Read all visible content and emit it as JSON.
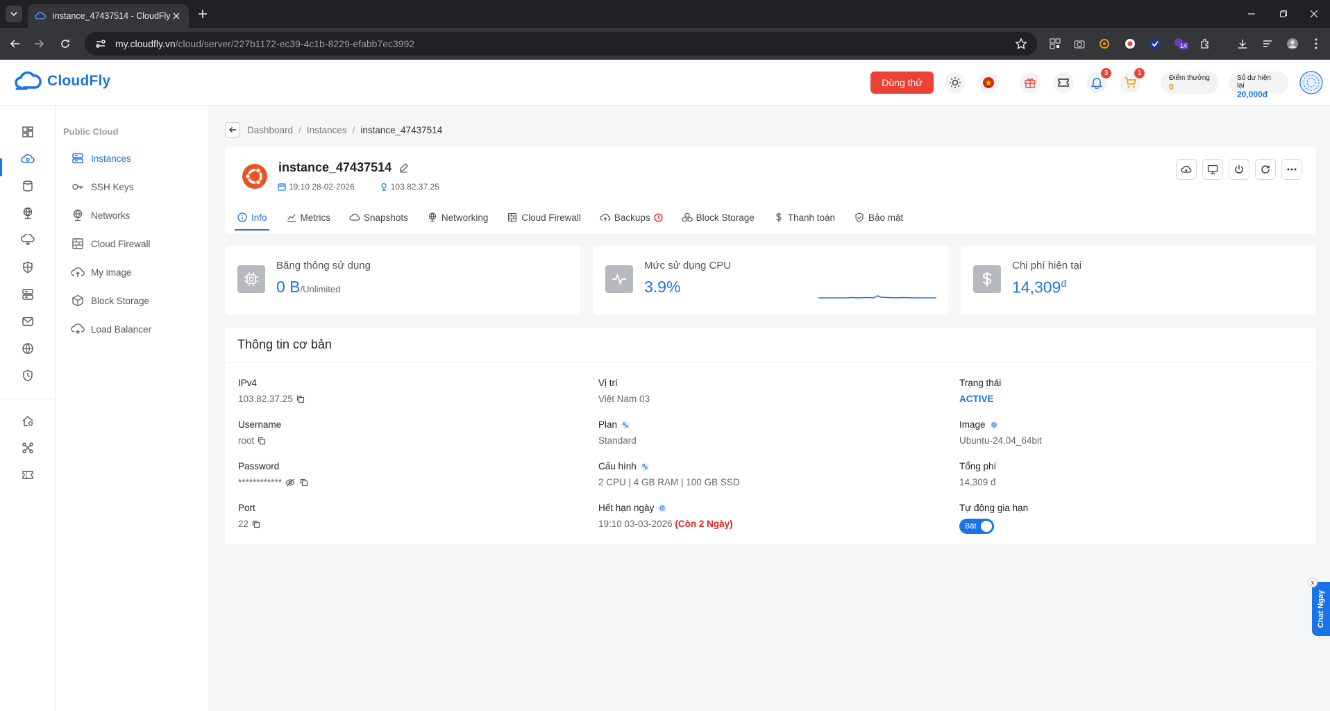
{
  "browser": {
    "tab_title": "instance_47437514 - CloudFly",
    "url_host": "my.cloudfly.vn",
    "url_path": "/cloud/server/227b1172-ec39-4c1b-8229-efabb7ec3992",
    "ext_badge": "14"
  },
  "header": {
    "logo_text": "CloudFly",
    "try_label": "Dùng thử",
    "notif_count": "3",
    "cart_count": "1",
    "points_label": "Điểm thưởng",
    "points_value": "0",
    "balance_label": "Số dư hiện tại",
    "balance_value": "20,000đ",
    "brand_color": "#1a73e8"
  },
  "sidebar": {
    "section": "Public Cloud",
    "items": [
      {
        "label": "Instances",
        "icon": "server-icon"
      },
      {
        "label": "SSH Keys",
        "icon": "key-icon"
      },
      {
        "label": "Networks",
        "icon": "network-icon"
      },
      {
        "label": "Cloud Firewall",
        "icon": "firewall-icon"
      },
      {
        "label": "My image",
        "icon": "cloud-upload-icon"
      },
      {
        "label": "Block Storage",
        "icon": "cube-icon"
      },
      {
        "label": "Load Balancer",
        "icon": "cloud-balance-icon"
      }
    ]
  },
  "breadcrumb": {
    "items": [
      "Dashboard",
      "Instances",
      "instance_47437514"
    ]
  },
  "instance": {
    "name": "instance_47437514",
    "created": "19:10 28-02-2026",
    "ip": "103.82.37.25"
  },
  "tabs": [
    "Info",
    "Metrics",
    "Snapshots",
    "Networking",
    "Cloud Firewall",
    "Backups",
    "Block Storage",
    "Thanh toán",
    "Bảo mật"
  ],
  "stats": [
    {
      "label": "Băng thông sử dụng",
      "value": "0 B",
      "suffix": "/Unlimited"
    },
    {
      "label": "Mức sử dụng CPU",
      "value": "3.9%"
    },
    {
      "label": "Chi phí hiện tại",
      "value": "14,309",
      "suffix": "đ"
    }
  ],
  "info": {
    "title": "Thông tin cơ bản",
    "ipv4_label": "IPv4",
    "ipv4": "103.82.37.25",
    "username_label": "Username",
    "username": "root",
    "password_label": "Password",
    "password": "************",
    "port_label": "Port",
    "port": "22",
    "location_label": "Vị trí",
    "location": "Việt Nam 03",
    "plan_label": "Plan",
    "plan": "Standard",
    "config_label": "Cấu hình",
    "config": "2 CPU | 4 GB RAM | 100 GB SSD",
    "expiry_label": "Hết hạn ngày",
    "expiry": "19:10 03-03-2026",
    "remain_prefix": "(Còn ",
    "remain_days": "2",
    "remain_suffix": " Ngày)",
    "status_label": "Trạng thái",
    "status": "ACTIVE",
    "image_label": "Image",
    "image": "Ubuntu-24.04_64bit",
    "total_label": "Tổng phí",
    "total": "14,309 đ",
    "autorenew_label": "Tự động gia hạn",
    "autorenew": "Bật"
  },
  "chat": {
    "label": "Chat Ngay",
    "close": "x"
  }
}
